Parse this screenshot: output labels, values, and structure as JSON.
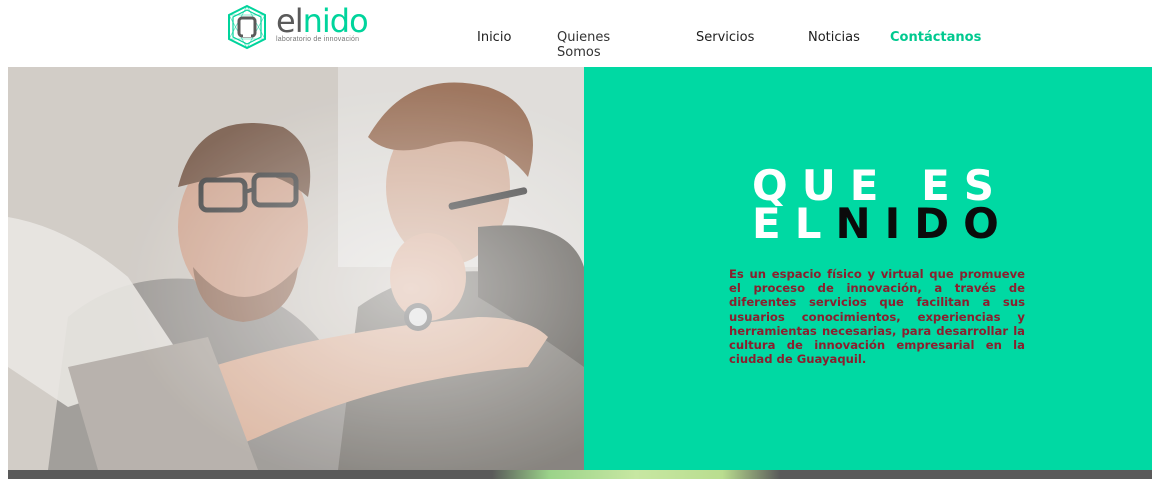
{
  "brand": {
    "name_prefix": "el",
    "name_suffix": "nido",
    "tagline": "laboratorio de innovación",
    "logo_letter": "n",
    "colors": {
      "accent": "#00d9a3",
      "dark": "#5a5a5a"
    }
  },
  "nav": {
    "items": [
      {
        "label": "Inicio"
      },
      {
        "label": "Quienes Somos"
      },
      {
        "label": "Servicios"
      },
      {
        "label": "Noticias"
      },
      {
        "label": "Contáctanos",
        "active": true
      }
    ]
  },
  "hero": {
    "title_line1": "QUE ES",
    "title_line2_light": "EL",
    "title_line2_dark": "NIDO",
    "description": "Es un espacio físico y virtual que promueve el proceso de innovación, a través de diferentes servicios que facilitan a sus usuarios conocimientos, experiencias y herramientas necesarias, para desarrollar la cultura de innovación empresarial en la ciudad de Guayaquil."
  }
}
